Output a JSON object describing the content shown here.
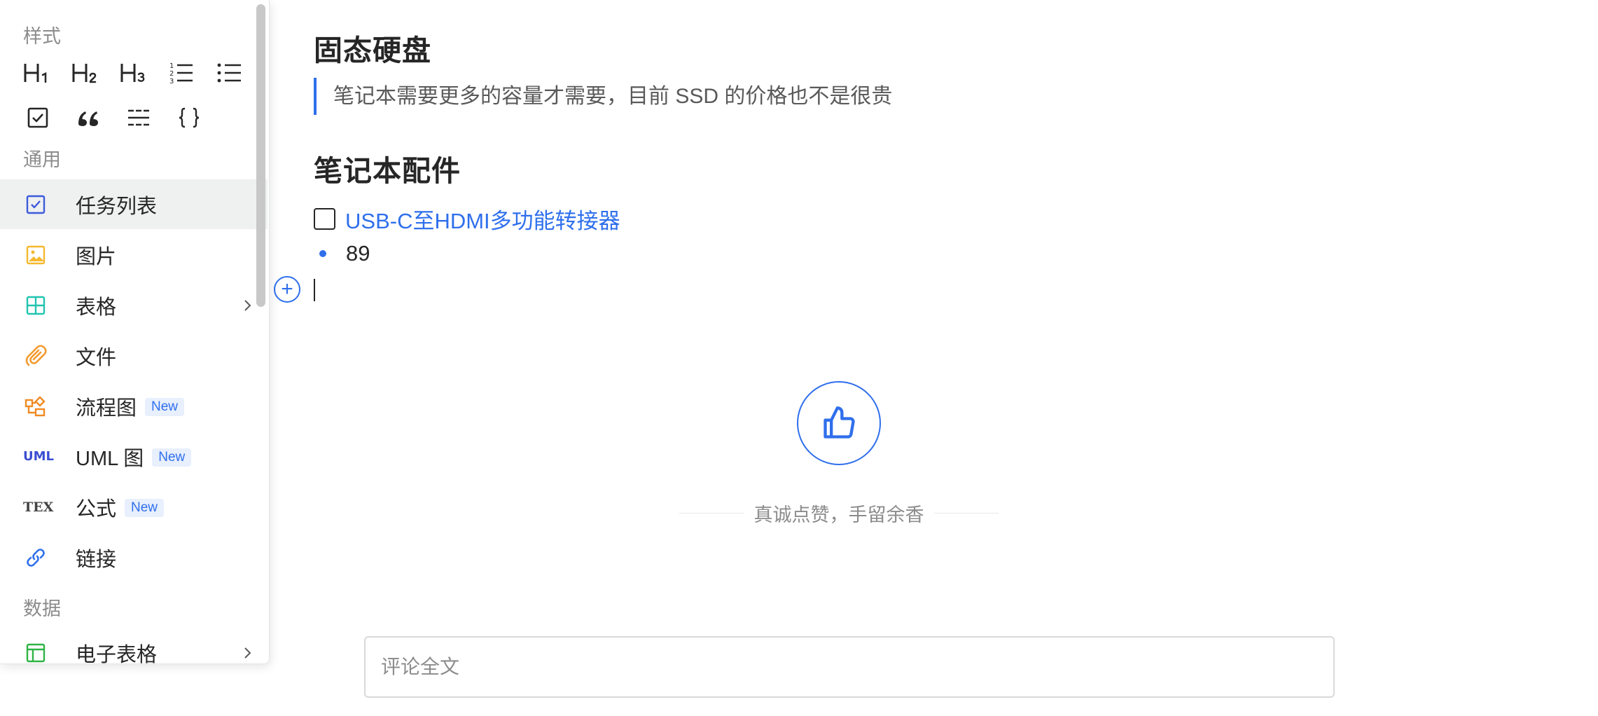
{
  "document": {
    "heading1": "固态硬盘",
    "quote": "笔记本需要更多的容量才需要，目前 SSD 的价格也不是很贵",
    "heading2": "笔记本配件",
    "task_item": "USB-C至HDMI多功能转接器",
    "bullet_item": "89",
    "add_block_symbol": "+",
    "like_caption": "真诚点赞，手留余香",
    "comment_placeholder": "评论全文"
  },
  "slash_menu": {
    "style_section": "样式",
    "style_tools": [
      "heading-1-icon",
      "heading-2-icon",
      "heading-3-icon",
      "ordered-list-icon",
      "bullet-list-icon",
      "checkbox-icon",
      "quote-icon",
      "divider-icon",
      "code-block-icon"
    ],
    "common_section": "通用",
    "items": [
      {
        "label": "任务列表",
        "icon": "task-list-icon",
        "badge": "",
        "submenu": false,
        "active": true
      },
      {
        "label": "图片",
        "icon": "image-icon",
        "badge": "",
        "submenu": false,
        "active": false
      },
      {
        "label": "表格",
        "icon": "table-icon",
        "badge": "",
        "submenu": true,
        "active": false
      },
      {
        "label": "文件",
        "icon": "paperclip-icon",
        "badge": "",
        "submenu": false,
        "active": false
      },
      {
        "label": "流程图",
        "icon": "flowchart-icon",
        "badge": "New",
        "submenu": false,
        "active": false
      },
      {
        "label": "UML 图",
        "icon": "uml-icon",
        "badge": "New",
        "submenu": false,
        "active": false
      },
      {
        "label": "公式",
        "icon": "tex-icon",
        "badge": "New",
        "submenu": false,
        "active": false
      },
      {
        "label": "链接",
        "icon": "link-icon",
        "badge": "",
        "submenu": false,
        "active": false
      }
    ],
    "data_section": "数据",
    "data_items": [
      {
        "label": "电子表格",
        "icon": "spreadsheet-icon",
        "badge": "",
        "submenu": true
      }
    ],
    "icon_text": {
      "uml": "UML",
      "tex": "TEX"
    }
  },
  "colors": {
    "accent": "#2f6fec",
    "task_icon": "#3b5bdb",
    "image_icon": "#f5b82e",
    "table_icon": "#20c4b0",
    "file_icon": "#f39a2e",
    "flowchart_icon": "#f08a24",
    "uml_icon": "#3b4fd0",
    "tex_icon": "#444444",
    "link_icon": "#2f6fec",
    "spreadsheet_icon": "#2fb344"
  }
}
